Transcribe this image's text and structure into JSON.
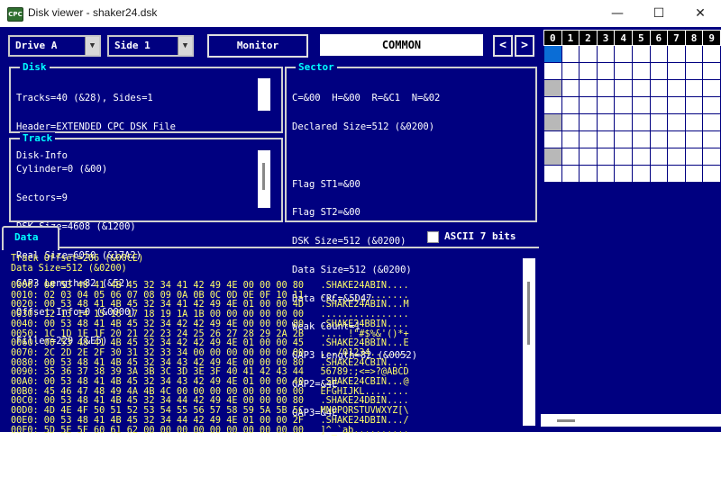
{
  "window": {
    "title": "Disk viewer - shaker24.dsk",
    "icon_text": "CPC",
    "minimize": "—",
    "maximize": "☐",
    "close": "✕"
  },
  "toolbar": {
    "drive_value": "Drive A",
    "side_value": "Side 1",
    "monitor_label": "Monitor",
    "common_label": "COMMON",
    "prev_label": "<",
    "next_label": ">"
  },
  "disk_panel": {
    "title": "Disk",
    "lines": [
      "Tracks=40 (&28), Sides=1",
      "Header=EXTENDED CPC DSK File",
      "Disk-Info"
    ]
  },
  "sector_panel": {
    "title": "Sector",
    "lines": [
      "C=&00  H=&00  R=&C1  N=&02",
      "Declared Size=512 (&0200)",
      "",
      "Flag ST1=&00",
      "Flag ST2=&00",
      "DSK Size=512 (&0200)",
      "Data Size=512 (&0200)",
      "Data CRC=&5D47",
      "Weak Count=1",
      "GAP3 Length=82 (&0052)",
      "GAP2=&4E",
      "GAP3=&4E",
      "CHRN CRC=&DC3B",
      "Offset-Info=0 (&0000)"
    ]
  },
  "track_panel": {
    "title": "Track",
    "lines": [
      "Cylinder=0 (&00)",
      "Sectors=9",
      "DSK Size=4608 (&1200)",
      "Real Size=6050 (&17A2)",
      "GAP3 Length=82 (&52)",
      "Offset-Info=0 (&0000)",
      "Filler=229 (&E5)"
    ]
  },
  "data_panel": {
    "tab_label": "Data",
    "ascii_label": "ASCII 7 bits",
    "header_lines": [
      "Track Offset=206 (&00CE)",
      "Data Size=512 (&0200)"
    ],
    "dump_lines": [
      "0000: 00 53 48 41 4B 45 32 34 41 42 49 4E 00 00 00 80   .SHAKE24ABIN....",
      "0010: 02 03 04 05 06 07 08 09 0A 0B 0C 0D 0E 0F 10 11   ................",
      "0020: 00 53 48 41 4B 45 32 34 41 42 49 4E 01 00 00 4D   .SHAKE24ABIN...M",
      "0030: 12 13 14 15 16 17 18 19 1A 1B 00 00 00 00 00 00   ................",
      "0040: 00 53 48 41 4B 45 32 34 42 42 49 4E 00 00 00 80   .SHAKE24BBIN....",
      "0050: 1C 1D 1E 1F 20 21 22 23 24 25 26 27 28 29 2A 2B   .... !\"#$%&'()*+",
      "0060: 00 53 48 41 4B 45 32 34 42 42 49 4E 01 00 00 45   .SHAKE24BBIN...E",
      "0070: 2C 2D 2E 2F 30 31 32 33 34 00 00 00 00 00 00 00   ,-./01234.......",
      "0080: 00 53 48 41 4B 45 32 34 43 42 49 4E 00 00 00 80   .SHAKE24CBIN....",
      "0090: 35 36 37 38 39 3A 3B 3C 3D 3E 3F 40 41 42 43 44   56789:;<=>?@ABCD",
      "00A0: 00 53 48 41 4B 45 32 34 43 42 49 4E 01 00 00 40   .SHAKE24CBIN...@",
      "00B0: 45 46 47 48 49 4A 4B 4C 00 00 00 00 00 00 00 00   EFGHIJKL........",
      "00C0: 00 53 48 41 4B 45 32 34 44 42 49 4E 00 00 00 80   .SHAKE24DBIN....",
      "00D0: 4D 4E 4F 50 51 52 53 54 55 56 57 58 59 5A 5B 5C   MNOPQRSTUVWXYZ[\\",
      "00E0: 00 53 48 41 4B 45 32 34 44 42 49 4E 01 00 00 2F   .SHAKE24DBIN.../",
      "00F0: 5D 5E 5F 60 61 62 00 00 00 00 00 00 00 00 00 00   ]^_`ab.........."
    ]
  },
  "track_grid": {
    "headers": [
      "0",
      "1",
      "2",
      "3",
      "4",
      "5",
      "6",
      "7",
      "8",
      "9"
    ],
    "rows": 8,
    "selected_cells": [
      [
        0,
        0
      ]
    ],
    "grey_cells": [
      [
        2,
        0
      ],
      [
        4,
        0
      ],
      [
        6,
        0
      ]
    ]
  }
}
